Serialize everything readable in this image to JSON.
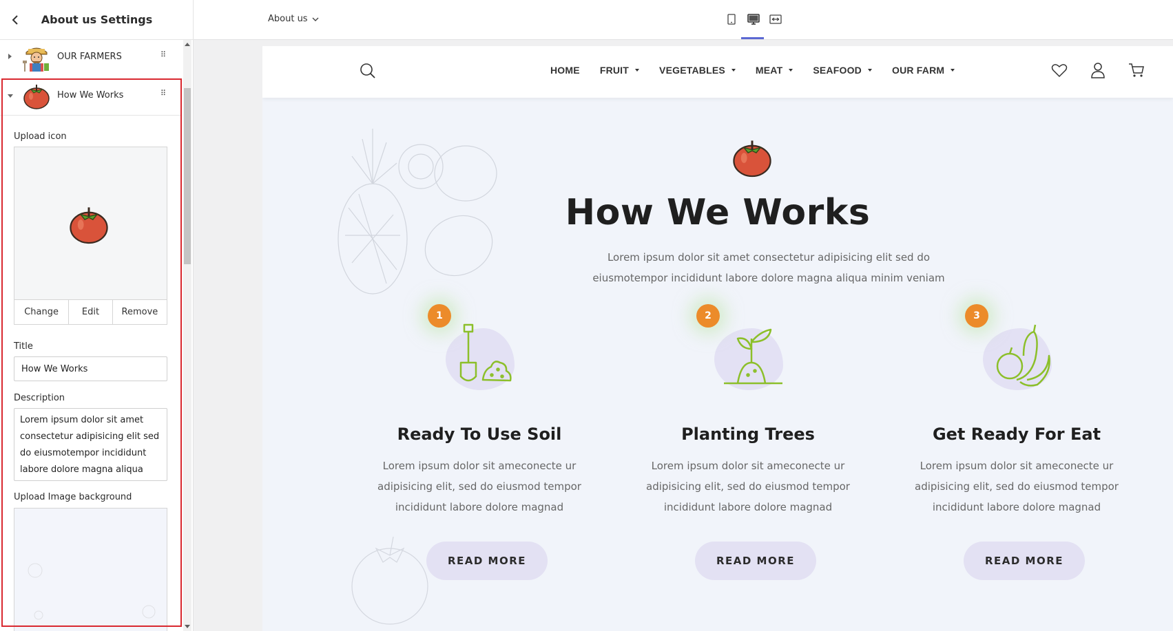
{
  "sidebar": {
    "title": "About us Settings",
    "items": [
      {
        "label": "OUR FARMERS"
      },
      {
        "label": "How We Works"
      }
    ],
    "upload_icon_label": "Upload icon",
    "btn_change": "Change",
    "btn_edit": "Edit",
    "btn_remove": "Remove",
    "title_label": "Title",
    "title_value": "How We Works",
    "description_label": "Description",
    "description_value": "Lorem ipsum dolor sit amet consectetur adipisicing elit sed do eiusmotempor incididunt labore dolore magna aliqua",
    "upload_bg_label": "Upload Image background",
    "highlight_color": "#d9282f"
  },
  "toolbar": {
    "page_select": "About us",
    "devices": [
      "mobile-icon",
      "desktop-icon",
      "fullwidth-icon"
    ],
    "active_device": "desktop-icon",
    "accent": "#5b68d3"
  },
  "site": {
    "nav": [
      {
        "label": "HOME",
        "dropdown": false
      },
      {
        "label": "FRUIT",
        "dropdown": true
      },
      {
        "label": "VEGETABLES",
        "dropdown": true
      },
      {
        "label": "MEAT",
        "dropdown": true
      },
      {
        "label": "SEAFOOD",
        "dropdown": true
      },
      {
        "label": "OUR FARM",
        "dropdown": true
      }
    ],
    "hero_title": "How We Works",
    "hero_desc": "Lorem ipsum dolor sit amet consectetur adipisicing elit sed do eiusmotempor incididunt labore dolore magna aliqua minim veniam",
    "steps": [
      {
        "num": "1",
        "title": "Ready To Use Soil",
        "desc": "Lorem ipsum dolor sit ameconecte ur adipisicing elit, sed do eiusmod tempor incididunt labore dolore magnad",
        "button": "READ MORE"
      },
      {
        "num": "2",
        "title": "Planting Trees",
        "desc": "Lorem ipsum dolor sit ameconecte ur adipisicing elit, sed do eiusmod tempor incididunt labore dolore magnad",
        "button": "READ MORE"
      },
      {
        "num": "3",
        "title": "Get Ready For Eat",
        "desc": "Lorem ipsum dolor sit ameconecte ur adipisicing elit, sed do eiusmod tempor incididunt labore dolore magnad",
        "button": "READ MORE"
      }
    ],
    "badge_color": "#ec8b2a",
    "green": "#8cbf2a"
  }
}
